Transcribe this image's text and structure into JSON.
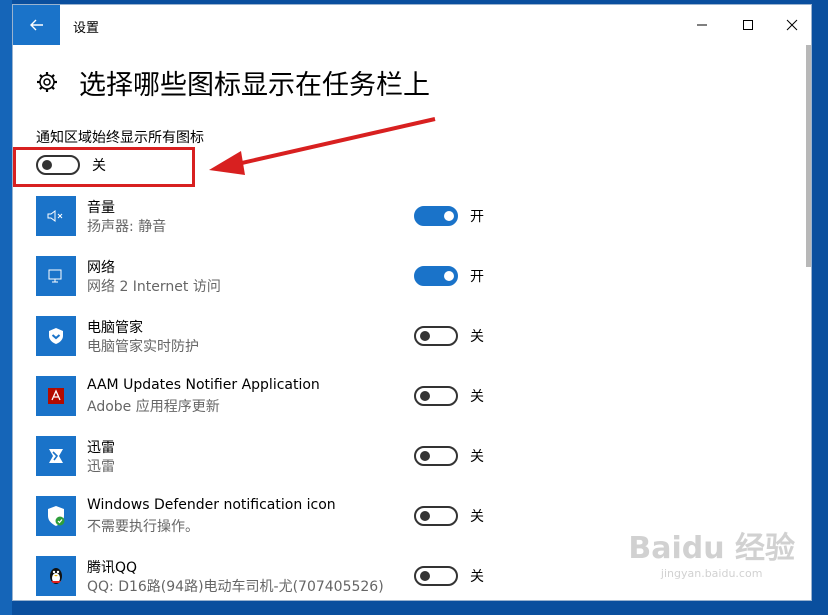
{
  "window": {
    "title": "设置"
  },
  "page": {
    "title": "选择哪些图标显示在任务栏上"
  },
  "always_show": {
    "label": "通知区域始终显示所有图标",
    "state": "关",
    "on": false
  },
  "apps": [
    {
      "name": "音量",
      "sub": "扬声器: 静音",
      "state": "开",
      "on": true,
      "icon": "speaker-mute-icon"
    },
    {
      "name": "网络",
      "sub": "网络  2 Internet 访问",
      "state": "开",
      "on": true,
      "icon": "network-icon"
    },
    {
      "name": "电脑管家",
      "sub": "电脑管家实时防护",
      "state": "关",
      "on": false,
      "icon": "shield-icon"
    },
    {
      "name": "AAM Updates Notifier Application",
      "sub": "Adobe 应用程序更新",
      "state": "关",
      "on": false,
      "icon": "adobe-icon"
    },
    {
      "name": "迅雷",
      "sub": "迅雷",
      "state": "关",
      "on": false,
      "icon": "thunder-icon"
    },
    {
      "name": "Windows Defender notification icon",
      "sub": "不需要执行操作。",
      "state": "关",
      "on": false,
      "icon": "defender-shield-icon"
    },
    {
      "name": "腾讯QQ",
      "sub": "QQ: D16路(94路)电动车司机-尤(707405526)",
      "state": "关",
      "on": false,
      "icon": "qq-penguin-icon"
    }
  ],
  "watermark": {
    "main": "Baidu 经验",
    "sub": "jingyan.baidu.com"
  },
  "colors": {
    "accent": "#1a73c9",
    "highlight": "#d82020"
  }
}
